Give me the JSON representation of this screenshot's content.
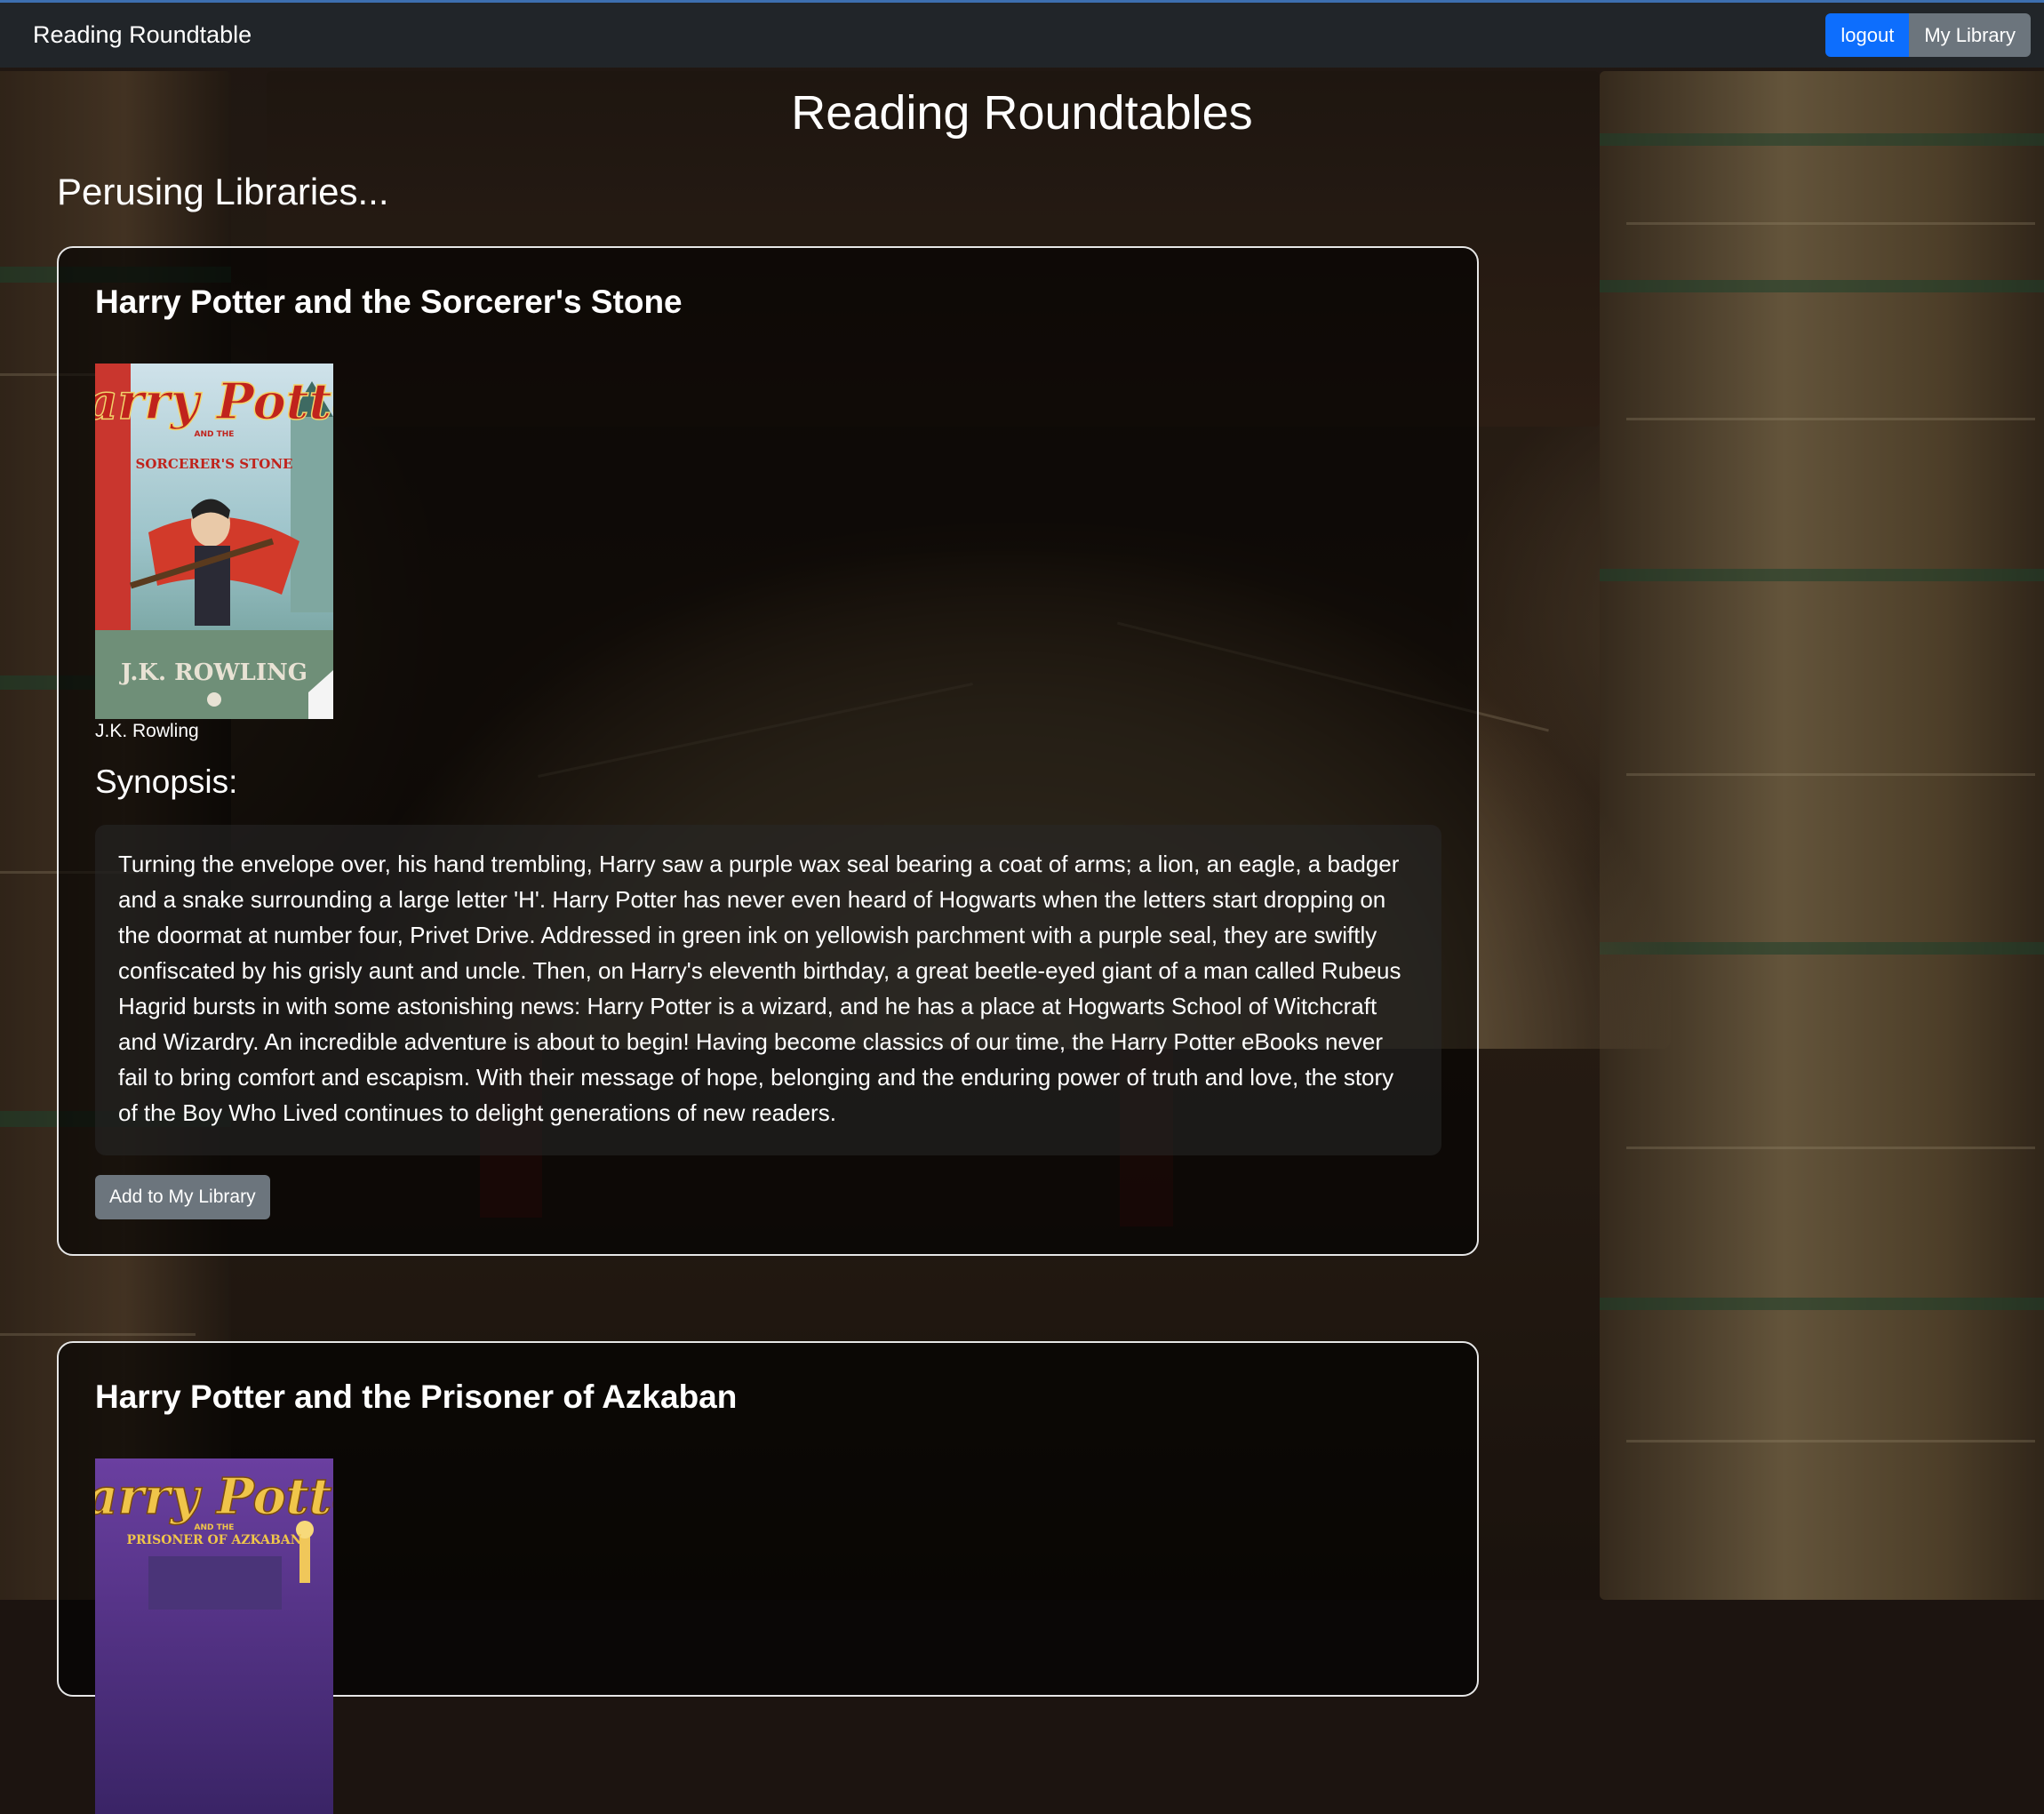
{
  "navbar": {
    "brand": "Reading Roundtable",
    "logout_label": "logout",
    "my_library_label": "My Library"
  },
  "main": {
    "title": "Reading Roundtables",
    "section_title": "Perusing Libraries..."
  },
  "books": [
    {
      "title": "Harry Potter and the Sorcerer's Stone",
      "author": "J.K. Rowling",
      "synopsis_heading": "Synopsis:",
      "synopsis": "Turning the envelope over, his hand trembling, Harry saw a purple wax seal bearing a coat of arms; a lion, an eagle, a badger and a snake surrounding a large letter 'H'. Harry Potter has never even heard of Hogwarts when the letters start dropping on the doormat at number four, Privet Drive. Addressed in green ink on yellowish parchment with a purple seal, they are swiftly confiscated by his grisly aunt and uncle. Then, on Harry's eleventh birthday, a great beetle-eyed giant of a man called Rubeus Hagrid bursts in with some astonishing news: Harry Potter is a wizard, and he has a place at Hogwarts School of Witchcraft and Wizardry. An incredible adventure is about to begin! Having become classics of our time, the Harry Potter eBooks never fail to bring comfort and escapism. With their message of hope, belonging and the enduring power of truth and love, the story of the Boy Who Lived continues to delight generations of new readers.",
      "add_label": "Add to My Library",
      "cover": {
        "title_art": "Harry Potter",
        "subtitle_art": "SORCERER'S STONE",
        "author_art": "J.K. ROWLING"
      }
    },
    {
      "title": "Harry Potter and the Prisoner of Azkaban",
      "cover": {
        "title_art": "Harry Potter",
        "subtitle_art": "PRISONER OF AZKABAN"
      }
    }
  ],
  "colors": {
    "navbar_bg": "#212529",
    "primary": "#0d6efd",
    "secondary": "#6c757d"
  }
}
